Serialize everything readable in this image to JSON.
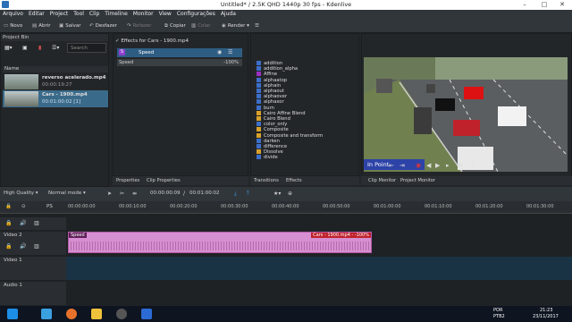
{
  "window": {
    "title": "Untitled* / 2.5K QHD 1440p 30 fps - Kdenlive"
  },
  "menu": [
    "Arquivo",
    "Editar",
    "Project",
    "Tool",
    "Clip",
    "Timeline",
    "Monitor",
    "View",
    "Configurações",
    "Ajuda"
  ],
  "toolbar": {
    "new": "Novo",
    "open": "Abrir",
    "save": "Salvar",
    "undo": "Desfazer",
    "redo": "Refazer",
    "copy": "Copiar",
    "paste": "Colar",
    "render": "Render"
  },
  "bin": {
    "title": "Project Bin",
    "search_placeholder": "Search",
    "col_name": "Name",
    "clips": [
      {
        "name": "reverso acelerado.mp4",
        "duration": "00:00:19:27"
      },
      {
        "name": "Cars - 1900.mp4",
        "duration": "00:01:00:02 [1]"
      }
    ]
  },
  "effect_stack": {
    "header": "Effects for Cars - 1900.mp4",
    "effect_name": "Speed",
    "param_label": "Speed",
    "param_value": "-100%"
  },
  "effects_list": [
    "addition",
    "addition_alpha",
    "Affine",
    "alphaatop",
    "alphain",
    "alphaout",
    "alphaover",
    "alphaxor",
    "burn",
    "Cairo Affine Blend",
    "Cairo Blend",
    "color_only",
    "Composite",
    "Composite and transform",
    "darken",
    "difference",
    "Dissolve",
    "divide"
  ],
  "effects_colors": [
    "#3d6ec9",
    "#3d6ec9",
    "#9c2fc2",
    "#3d6ec9",
    "#3d6ec9",
    "#3d6ec9",
    "#3d6ec9",
    "#3d6ec9",
    "#3d6ec9",
    "#d8a12a",
    "#d8a12a",
    "#3d6ec9",
    "#d8a12a",
    "#d8a12a",
    "#3d6ec9",
    "#3d6ec9",
    "#d8a12a",
    "#3d6ec9"
  ],
  "tabs_left": {
    "properties": "Properties",
    "clip_properties": "Clip Properties"
  },
  "tabs_mid": {
    "transitions": "Transitions",
    "effects": "Effects"
  },
  "monitor": {
    "overlay": "In Point",
    "tab_clip": "Clip Monitor",
    "tab_project": "Project Monitor"
  },
  "timeline": {
    "quality": "High Quality",
    "mode": "Normal mode",
    "timecode": "00:00:00:09",
    "duration": "00:01:00:02",
    "ruler": [
      "00:00:00:00",
      "00:00:10:00",
      "00:00:20:00",
      "00:00:30:00",
      "00:00:40:00",
      "00:00:50:00",
      "00:01:00:00",
      "00:01:10:00",
      "00:01:20:00",
      "00:01:30:00"
    ],
    "tracks": {
      "v2": "Video 2",
      "v1": "Video 1",
      "a1": "Audio 1"
    },
    "clip_speed_label": "Speed",
    "clip_label": "Cars - 1900.mp4 - -100%"
  },
  "taskbar": {
    "time": "21:23",
    "date": "23/11/2017",
    "lang": "POR",
    "kbd": "PTB2"
  }
}
